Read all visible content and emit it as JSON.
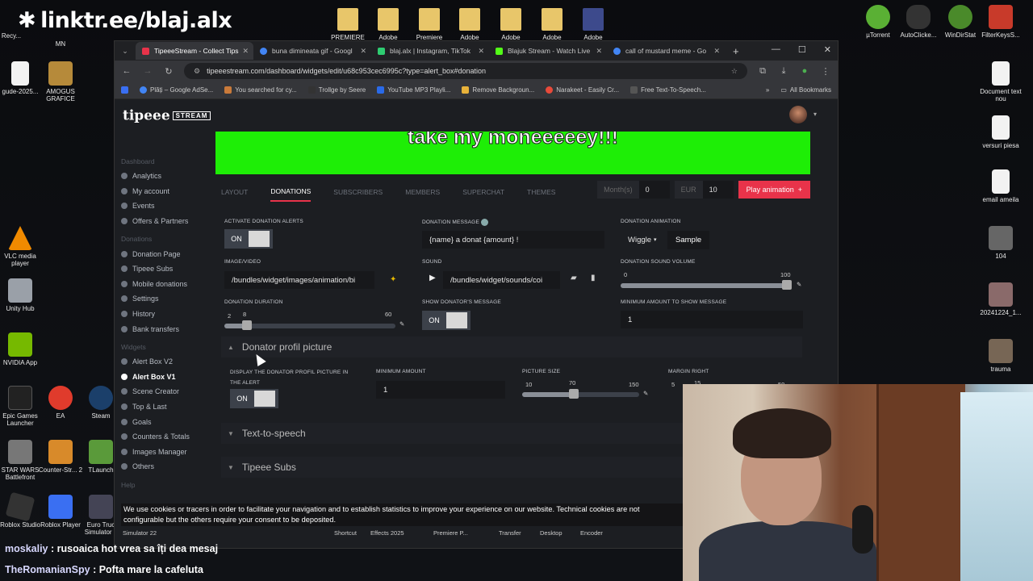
{
  "overlay": {
    "link": "linktr.ee/blaj.alx"
  },
  "desktop": {
    "left_icons": [
      "Recy...",
      "MN",
      "gude-2025...",
      "AMOGUS GRAFICE",
      "VLC media player",
      "Unity Hub",
      "NVIDIA App",
      "Epic Games Launcher",
      "EA",
      "Steam",
      "STAR WARS Battlefront",
      "Counter-Str... 2",
      "TLaunch",
      "Roblox Studio",
      "Roblox Player",
      "Euro Truc Simulator 2"
    ],
    "top_folders": [
      "PREMIERE",
      "Adobe",
      "Premiere",
      "Adobe",
      "Adobe",
      "Adobe",
      "Adobe"
    ],
    "right_icons": [
      "µTorrent",
      "AutoClicke...",
      "WinDirStat",
      "FilterKeysS...",
      "Document text nou",
      "versuri piesa",
      "email ameila",
      "104",
      "20241224_1...",
      "trauma"
    ]
  },
  "browser": {
    "tabs": [
      {
        "title": "TipeeeStream - Collect Tips",
        "color": "#e8334a"
      },
      {
        "title": "buna dimineata gif - Googl",
        "color": "#4285f4"
      },
      {
        "title": "blaj.alx | Instagram, TikTok",
        "color": "#2ecc71"
      },
      {
        "title": "Blajuk Stream - Watch Live",
        "color": "#53fc18"
      },
      {
        "title": "call of mustard meme - Go",
        "color": "#4285f4"
      }
    ],
    "url": "tipeeestream.com/dashboard/widgets/edit/u68c953cec6995c?type=alert_box#donation",
    "bookmarks": [
      "Plăți – Google AdSe...",
      "You searched for cy...",
      "Trollge by Seere",
      "YouTube MP3 Playli...",
      "Remove Backgroun...",
      "Narakeet - Easily Cr...",
      "Free Text-To-Speech..."
    ],
    "all_bookmarks": "All Bookmarks"
  },
  "site": {
    "logo": "tipeee",
    "logo_badge": "STREAM",
    "sidebar": {
      "dashboard_label": "Dashboard",
      "dashboard_items": [
        "Analytics",
        "My account",
        "Events",
        "Offers & Partners"
      ],
      "donations_label": "Donations",
      "donation_items": [
        "Donation Page",
        "Tipeee Subs",
        "Mobile donations",
        "Settings",
        "History",
        "Bank transfers"
      ],
      "widgets_label": "Widgets",
      "widget_items": [
        "Alert Box V2",
        "Alert Box V1",
        "Scene Creator",
        "Top & Last",
        "Goals",
        "Counters & Totals",
        "Images Manager",
        "Others"
      ],
      "help_label": "Help"
    },
    "preview_text": "take my moneeeeey!!!",
    "tabs": [
      "LAYOUT",
      "DONATIONS",
      "SUBSCRIBERS",
      "MEMBERS",
      "SUPERCHAT",
      "THEMES"
    ],
    "active_tab": "DONATIONS",
    "months_label": "Month(s)",
    "months_value": "0",
    "currency_label": "EUR",
    "amount_value": "10",
    "play_button": "Play animation",
    "form": {
      "activate_label": "ACTIVATE DONATION ALERTS",
      "toggle_on": "ON",
      "message_label": "DONATION MESSAGE",
      "message_value": "{name} a donat {amount} !",
      "animation_label": "DONATION ANIMATION",
      "animation_value": "Wiggle",
      "sample_button": "Sample",
      "image_label": "IMAGE/VIDEO",
      "image_value": "/bundles/widget/images/animation/bi",
      "sound_label": "SOUND",
      "sound_value": "/bundles/widget/sounds/coi",
      "volume_label": "DONATION SOUND VOLUME",
      "volume_min": "0",
      "volume_max": "100",
      "volume_level": 0.97,
      "duration_label": "DONATION DURATION",
      "duration_min": "2",
      "duration_value": "8",
      "duration_max": "60",
      "show_message_label": "SHOW DONATOR'S MESSAGE",
      "min_amount_message_label": "MINIMUM AMOUNT TO SHOW MESSAGE",
      "min_amount_message_value": "1"
    },
    "profile_section": {
      "title": "Donator profil picture",
      "display_label": "DISPLAY THE DONATOR PROFIL PICTURE IN THE ALERT",
      "min_amount_label": "MINIMUM AMOUNT",
      "min_amount_value": "1",
      "pic_size_label": "PICTURE SIZE",
      "pic_min": "10",
      "pic_value": "70",
      "pic_max": "150",
      "margin_label": "MARGIN RIGHT",
      "margin_min": "5",
      "margin_value": "15",
      "margin_max": "50"
    },
    "sections": [
      "Text-to-speech",
      "Tipeee Subs"
    ]
  },
  "cookie_text": "We use cookies or tracers in order to facilitate your navigation and to establish statistics to improve your experience on our website. Technical cookies are not configurable but the others require your consent to be deposited.",
  "taskbar_labels": [
    "Simulator 22",
    "Shortcut",
    "Effects 2025",
    "Premiere P...",
    "Transfer",
    "Desktop",
    "Encoder"
  ],
  "chat": [
    {
      "user": "moskaliy",
      "text": ": rusoaica hot vrea sa îți dea mesaj"
    },
    {
      "user": "TheRomanianSpy",
      "text": ": Pofta mare la cafeluta"
    }
  ]
}
